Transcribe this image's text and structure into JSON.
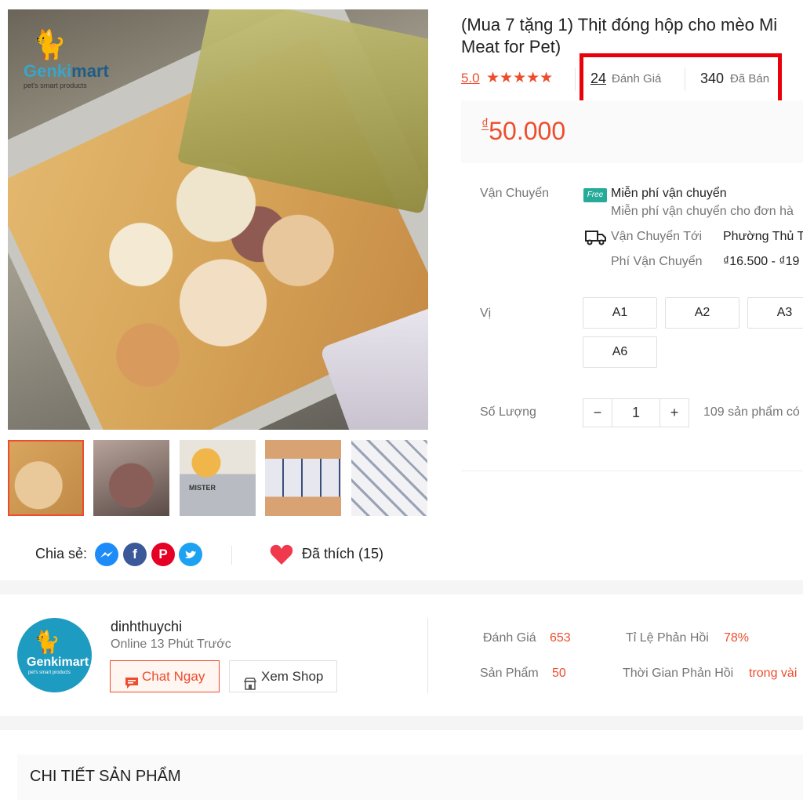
{
  "logo": {
    "brand_a": "Genki",
    "brand_b": "mart",
    "tagline": "pet's smart products"
  },
  "product": {
    "title_line1": "(Mua 7 tặng 1) Thịt đóng hộp cho mèo Mi",
    "title_line2": "Meat for Pet)",
    "rating": "5.0",
    "stars": "★★★★★",
    "reviews_count": "24",
    "reviews_label": "Đánh Giá",
    "sold_count": "340",
    "sold_label": "Đã Bán",
    "currency": "₫",
    "price": "50.000"
  },
  "shipping": {
    "label": "Vận Chuyển",
    "free_badge": "Free",
    "free_title": "Miễn phí vận chuyển",
    "free_sub": "Miễn phí vận chuyển cho đơn hà",
    "to_label": "Vận Chuyển Tới",
    "to_value": "Phường Thủ T",
    "fee_label": "Phí Vận Chuyển",
    "fee_value": "₫16.500 - ₫19"
  },
  "variants": {
    "label": "Vị",
    "options": [
      "A1",
      "A2",
      "A3",
      "A6"
    ]
  },
  "quantity": {
    "label": "Số Lượng",
    "minus": "−",
    "value": "1",
    "plus": "+",
    "stock": "109 sản phẩm có"
  },
  "share": {
    "label": "Chia sẻ:",
    "liked": "Đã thích (15)"
  },
  "shop": {
    "name": "dinhthuychi",
    "online": "Online 13 Phút Trước",
    "chat_button": "Chat Ngay",
    "view_button": "Xem Shop",
    "ratings_label": "Đánh Giá",
    "ratings_value": "653",
    "products_label": "Sản Phẩm",
    "products_value": "50",
    "response_rate_label": "Tỉ Lệ Phản Hồi",
    "response_rate_value": "78%",
    "response_time_label": "Thời Gian Phản Hồi",
    "response_time_value": "trong vài"
  },
  "details": {
    "title": "CHI TIẾT SẢN PHẨM"
  },
  "thumb_can": {
    "brand": "MISTER"
  },
  "colors": {
    "accent": "#ee4d2d",
    "highlight_box": "#e8000b",
    "free_badge": "#26aa99"
  }
}
